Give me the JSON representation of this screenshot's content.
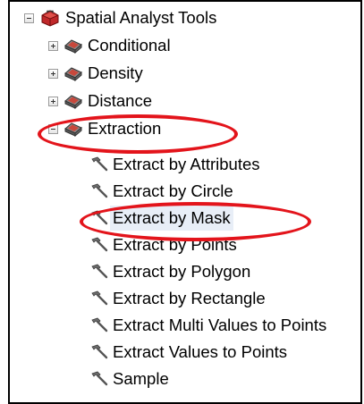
{
  "tree": {
    "root": {
      "label": "Spatial Analyst Tools",
      "icon": "toolbox-icon"
    },
    "toolsets": [
      {
        "label": "Conditional",
        "icon": "toolset-icon",
        "expanded": false
      },
      {
        "label": "Density",
        "icon": "toolset-icon",
        "expanded": false
      },
      {
        "label": "Distance",
        "icon": "toolset-icon",
        "expanded": false
      },
      {
        "label": "Extraction",
        "icon": "toolset-icon",
        "expanded": true
      }
    ],
    "tools": [
      {
        "label": "Extract by Attributes",
        "icon": "hammer-icon"
      },
      {
        "label": "Extract by Circle",
        "icon": "hammer-icon"
      },
      {
        "label": "Extract by Mask",
        "icon": "hammer-icon",
        "selected": true
      },
      {
        "label": "Extract by Points",
        "icon": "hammer-icon"
      },
      {
        "label": "Extract by Polygon",
        "icon": "hammer-icon"
      },
      {
        "label": "Extract by Rectangle",
        "icon": "hammer-icon"
      },
      {
        "label": "Extract Multi Values to Points",
        "icon": "hammer-icon"
      },
      {
        "label": "Extract Values to Points",
        "icon": "hammer-icon"
      },
      {
        "label": "Sample",
        "icon": "hammer-icon"
      }
    ]
  },
  "annotations": {
    "color": "#e3141b",
    "circled": [
      "Extraction",
      "Extract by Mask"
    ]
  }
}
